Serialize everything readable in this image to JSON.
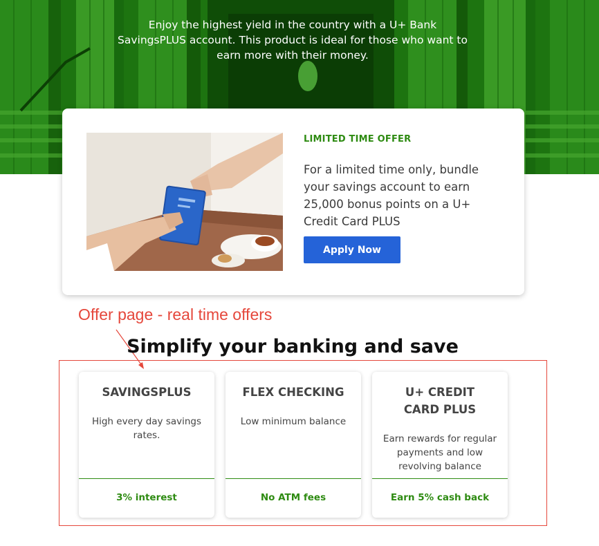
{
  "hero": {
    "text": "Enjoy the highest yield in the country with a U+ Bank SavingsPLUS account. This product is ideal for those who want to earn more with their money."
  },
  "offer": {
    "label": "LIMITED TIME OFFER",
    "body": "For a limited time only, bundle your savings account to earn 25,000 bonus points on a U+ Credit Card PLUS",
    "button_label": "Apply Now"
  },
  "annotation": {
    "text": "Offer page - real time offers"
  },
  "section": {
    "title": "Simplify your banking and save"
  },
  "products": [
    {
      "title": "SAVINGSPLUS",
      "description": "High every day savings rates.",
      "footer": "3% interest"
    },
    {
      "title": "FLEX CHECKING",
      "description": "Low minimum balance",
      "footer": "No ATM fees"
    },
    {
      "title": "U+ CREDIT CARD PLUS",
      "description": "Earn rewards for regular payments and low revolving balance",
      "footer": "Earn 5% cash back"
    }
  ],
  "colors": {
    "hero_green": "#1e7a12",
    "accent_green": "#2e8b12",
    "button_blue": "#2563d8",
    "annotation_red": "#e5473b"
  }
}
